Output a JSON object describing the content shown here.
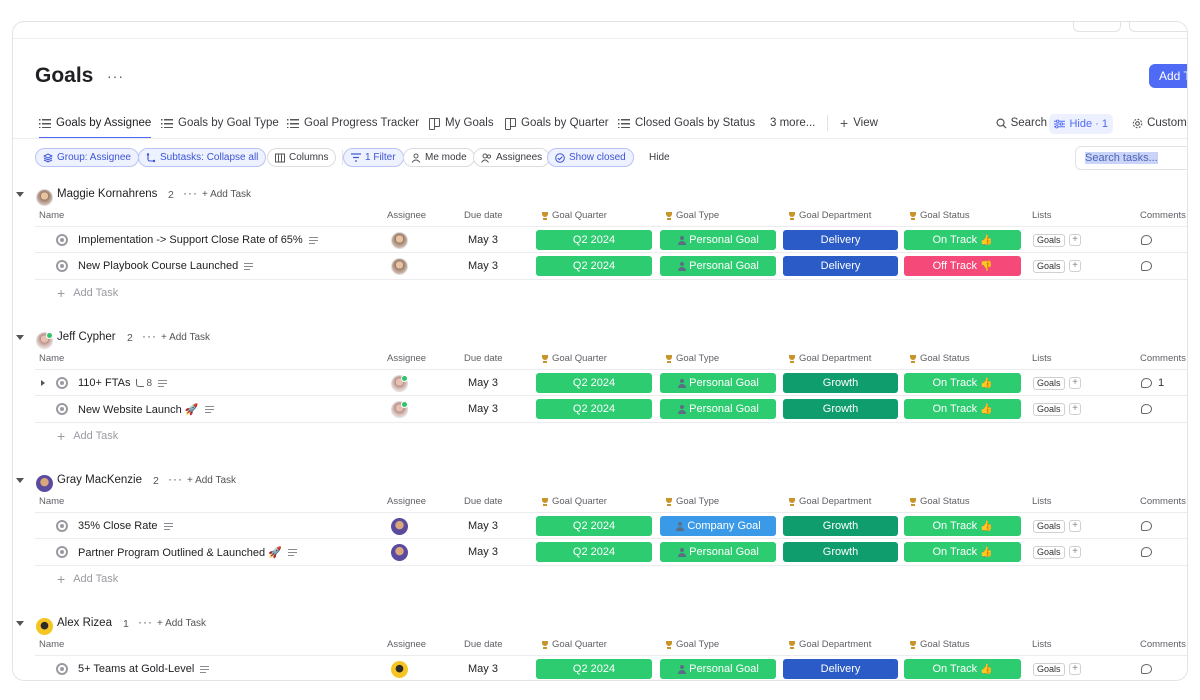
{
  "page": {
    "title": "Goals",
    "more": "···",
    "add_task_label": "Add T"
  },
  "tabs": [
    {
      "label": "Goals by Assignee",
      "icon": "list-icon",
      "active": true
    },
    {
      "label": "Goals by Goal Type",
      "icon": "list-icon"
    },
    {
      "label": "Goal Progress Tracker",
      "icon": "list-icon"
    },
    {
      "label": "My Goals",
      "icon": "board-icon"
    },
    {
      "label": "Goals by Quarter",
      "icon": "board-icon"
    },
    {
      "label": "Closed Goals by Status",
      "icon": "list-icon"
    },
    {
      "label": "3 more..."
    },
    {
      "label": "View",
      "icon": "plus-icon"
    }
  ],
  "toolbar": {
    "search_label": "Search",
    "hide_label": "Hide · 1",
    "customize_label": "Customiz"
  },
  "filters": {
    "group": "Group: Assignee",
    "subtasks": "Subtasks: Collapse all",
    "columns": "Columns",
    "filter": "1 Filter",
    "me_mode": "Me mode",
    "assignees": "Assignees",
    "show_closed": "Show closed",
    "hide": "Hide",
    "search_placeholder": "Search tasks..."
  },
  "columns": {
    "name": "Name",
    "assignee": "Assignee",
    "due_date": "Due date",
    "goal_quarter": "Goal Quarter",
    "goal_type": "Goal Type",
    "goal_department": "Goal Department",
    "goal_status": "Goal Status",
    "lists": "Lists",
    "comments": "Comments"
  },
  "add_task_label": "Add Task",
  "colors": {
    "quarter": "#2ecc71",
    "personal_goal": "#2ecc71",
    "company_goal": "#3b9ae8",
    "delivery": "#2a5bc7",
    "growth": "#0f9d6e",
    "on_track": "#2ecc71",
    "off_track": "#f5497a",
    "accent": "#4f6bf5"
  },
  "groups": [
    {
      "name": "Maggie Kornahrens",
      "count": "2",
      "avatar": "av-maggie",
      "tasks": [
        {
          "name": "Implementation -> Support Close Rate of 65%",
          "due": "May 3",
          "quarter": "Q2 2024",
          "type": "Personal Goal",
          "type_color": "personal_goal",
          "department": "Delivery",
          "dept_color": "delivery",
          "status": "On Track",
          "status_color": "on_track",
          "status_emoji": "thumbs-up",
          "list": "Goals"
        },
        {
          "name": "New Playbook Course Launched",
          "due": "May 3",
          "quarter": "Q2 2024",
          "type": "Personal Goal",
          "type_color": "personal_goal",
          "department": "Delivery",
          "dept_color": "delivery",
          "status": "Off Track",
          "status_color": "off_track",
          "status_emoji": "thumbs-down",
          "list": "Goals"
        }
      ]
    },
    {
      "name": "Jeff Cypher",
      "count": "2",
      "avatar": "av-jeff",
      "tasks": [
        {
          "name": "110+ FTAs",
          "subtasks": "8",
          "expandable": true,
          "due": "May 3",
          "quarter": "Q2 2024",
          "type": "Personal Goal",
          "type_color": "personal_goal",
          "department": "Growth",
          "dept_color": "growth",
          "status": "On Track",
          "status_color": "on_track",
          "status_emoji": "thumbs-up",
          "list": "Goals",
          "comments": "1"
        },
        {
          "name": "New Website Launch 🚀",
          "due": "May 3",
          "quarter": "Q2 2024",
          "type": "Personal Goal",
          "type_color": "personal_goal",
          "department": "Growth",
          "dept_color": "growth",
          "status": "On Track",
          "status_color": "on_track",
          "status_emoji": "thumbs-up",
          "list": "Goals"
        }
      ]
    },
    {
      "name": "Gray MacKenzie",
      "count": "2",
      "avatar": "av-gray",
      "tasks": [
        {
          "name": "35% Close Rate",
          "due": "May 3",
          "quarter": "Q2 2024",
          "type": "Company Goal",
          "type_color": "company_goal",
          "department": "Growth",
          "dept_color": "growth",
          "status": "On Track",
          "status_color": "on_track",
          "status_emoji": "thumbs-up",
          "list": "Goals"
        },
        {
          "name": "Partner Program Outlined & Launched 🚀",
          "due": "May 3",
          "quarter": "Q2 2024",
          "type": "Personal Goal",
          "type_color": "personal_goal",
          "department": "Growth",
          "dept_color": "growth",
          "status": "On Track",
          "status_color": "on_track",
          "status_emoji": "thumbs-up",
          "list": "Goals"
        }
      ]
    },
    {
      "name": "Alex Rizea",
      "count": "1",
      "avatar": "av-alex",
      "tasks": [
        {
          "name": "5+ Teams at Gold-Level",
          "due": "May 3",
          "quarter": "Q2 2024",
          "type": "Personal Goal",
          "type_color": "personal_goal",
          "department": "Delivery",
          "dept_color": "delivery",
          "status": "On Track",
          "status_color": "on_track",
          "status_emoji": "thumbs-up",
          "list": "Goals"
        }
      ]
    }
  ]
}
